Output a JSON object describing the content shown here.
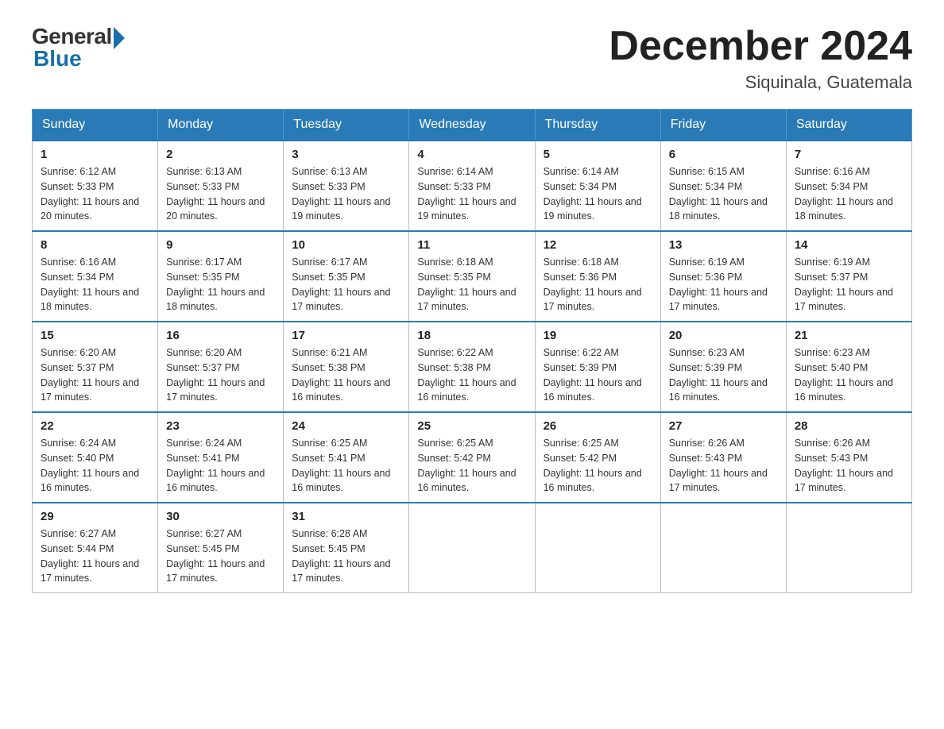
{
  "header": {
    "logo_general": "General",
    "logo_blue": "Blue",
    "month_title": "December 2024",
    "location": "Siquinala, Guatemala"
  },
  "weekdays": [
    "Sunday",
    "Monday",
    "Tuesday",
    "Wednesday",
    "Thursday",
    "Friday",
    "Saturday"
  ],
  "weeks": [
    [
      {
        "day": "1",
        "sunrise": "6:12 AM",
        "sunset": "5:33 PM",
        "daylight": "11 hours and 20 minutes."
      },
      {
        "day": "2",
        "sunrise": "6:13 AM",
        "sunset": "5:33 PM",
        "daylight": "11 hours and 20 minutes."
      },
      {
        "day": "3",
        "sunrise": "6:13 AM",
        "sunset": "5:33 PM",
        "daylight": "11 hours and 19 minutes."
      },
      {
        "day": "4",
        "sunrise": "6:14 AM",
        "sunset": "5:33 PM",
        "daylight": "11 hours and 19 minutes."
      },
      {
        "day": "5",
        "sunrise": "6:14 AM",
        "sunset": "5:34 PM",
        "daylight": "11 hours and 19 minutes."
      },
      {
        "day": "6",
        "sunrise": "6:15 AM",
        "sunset": "5:34 PM",
        "daylight": "11 hours and 18 minutes."
      },
      {
        "day": "7",
        "sunrise": "6:16 AM",
        "sunset": "5:34 PM",
        "daylight": "11 hours and 18 minutes."
      }
    ],
    [
      {
        "day": "8",
        "sunrise": "6:16 AM",
        "sunset": "5:34 PM",
        "daylight": "11 hours and 18 minutes."
      },
      {
        "day": "9",
        "sunrise": "6:17 AM",
        "sunset": "5:35 PM",
        "daylight": "11 hours and 18 minutes."
      },
      {
        "day": "10",
        "sunrise": "6:17 AM",
        "sunset": "5:35 PM",
        "daylight": "11 hours and 17 minutes."
      },
      {
        "day": "11",
        "sunrise": "6:18 AM",
        "sunset": "5:35 PM",
        "daylight": "11 hours and 17 minutes."
      },
      {
        "day": "12",
        "sunrise": "6:18 AM",
        "sunset": "5:36 PM",
        "daylight": "11 hours and 17 minutes."
      },
      {
        "day": "13",
        "sunrise": "6:19 AM",
        "sunset": "5:36 PM",
        "daylight": "11 hours and 17 minutes."
      },
      {
        "day": "14",
        "sunrise": "6:19 AM",
        "sunset": "5:37 PM",
        "daylight": "11 hours and 17 minutes."
      }
    ],
    [
      {
        "day": "15",
        "sunrise": "6:20 AM",
        "sunset": "5:37 PM",
        "daylight": "11 hours and 17 minutes."
      },
      {
        "day": "16",
        "sunrise": "6:20 AM",
        "sunset": "5:37 PM",
        "daylight": "11 hours and 17 minutes."
      },
      {
        "day": "17",
        "sunrise": "6:21 AM",
        "sunset": "5:38 PM",
        "daylight": "11 hours and 16 minutes."
      },
      {
        "day": "18",
        "sunrise": "6:22 AM",
        "sunset": "5:38 PM",
        "daylight": "11 hours and 16 minutes."
      },
      {
        "day": "19",
        "sunrise": "6:22 AM",
        "sunset": "5:39 PM",
        "daylight": "11 hours and 16 minutes."
      },
      {
        "day": "20",
        "sunrise": "6:23 AM",
        "sunset": "5:39 PM",
        "daylight": "11 hours and 16 minutes."
      },
      {
        "day": "21",
        "sunrise": "6:23 AM",
        "sunset": "5:40 PM",
        "daylight": "11 hours and 16 minutes."
      }
    ],
    [
      {
        "day": "22",
        "sunrise": "6:24 AM",
        "sunset": "5:40 PM",
        "daylight": "11 hours and 16 minutes."
      },
      {
        "day": "23",
        "sunrise": "6:24 AM",
        "sunset": "5:41 PM",
        "daylight": "11 hours and 16 minutes."
      },
      {
        "day": "24",
        "sunrise": "6:25 AM",
        "sunset": "5:41 PM",
        "daylight": "11 hours and 16 minutes."
      },
      {
        "day": "25",
        "sunrise": "6:25 AM",
        "sunset": "5:42 PM",
        "daylight": "11 hours and 16 minutes."
      },
      {
        "day": "26",
        "sunrise": "6:25 AM",
        "sunset": "5:42 PM",
        "daylight": "11 hours and 16 minutes."
      },
      {
        "day": "27",
        "sunrise": "6:26 AM",
        "sunset": "5:43 PM",
        "daylight": "11 hours and 17 minutes."
      },
      {
        "day": "28",
        "sunrise": "6:26 AM",
        "sunset": "5:43 PM",
        "daylight": "11 hours and 17 minutes."
      }
    ],
    [
      {
        "day": "29",
        "sunrise": "6:27 AM",
        "sunset": "5:44 PM",
        "daylight": "11 hours and 17 minutes."
      },
      {
        "day": "30",
        "sunrise": "6:27 AM",
        "sunset": "5:45 PM",
        "daylight": "11 hours and 17 minutes."
      },
      {
        "day": "31",
        "sunrise": "6:28 AM",
        "sunset": "5:45 PM",
        "daylight": "11 hours and 17 minutes."
      },
      null,
      null,
      null,
      null
    ]
  ]
}
